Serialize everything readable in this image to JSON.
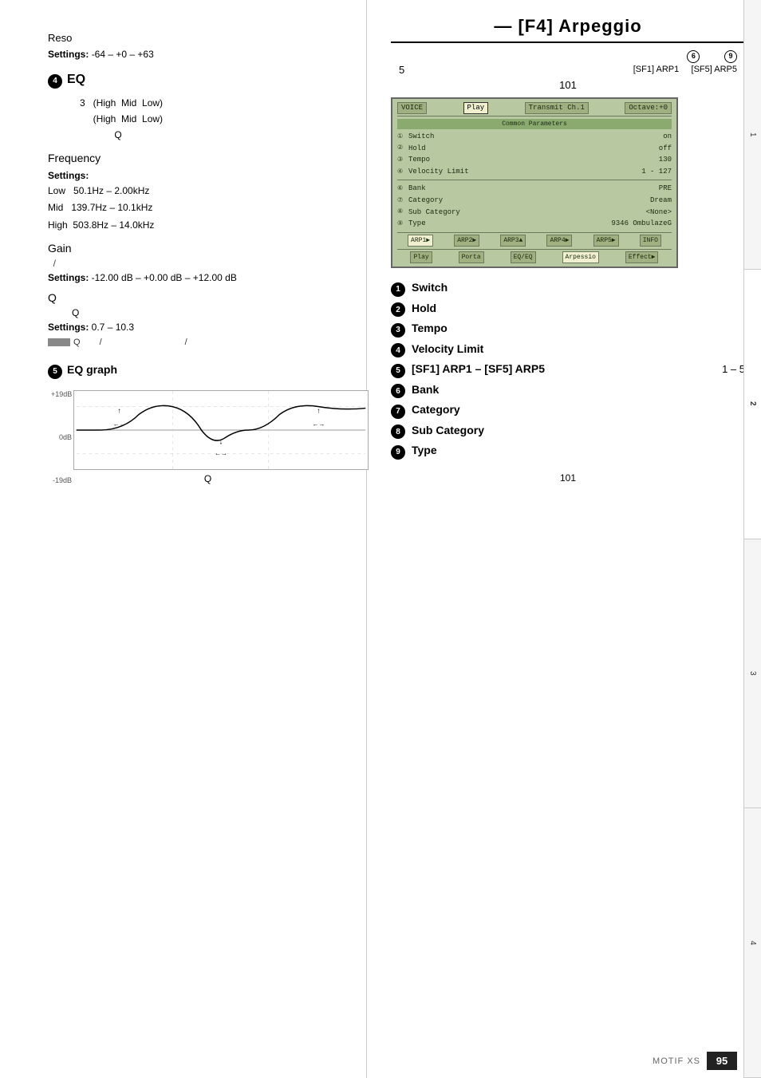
{
  "left": {
    "reso_label": "Reso",
    "settings_reso": "Settings: -64 – +0 – +63",
    "eq_section": {
      "circle_num": "4",
      "title": "EQ",
      "table_rows": [
        {
          "num": "3",
          "cols": [
            "(High",
            "Mid",
            "Low)"
          ]
        },
        {
          "cols": [
            "(High",
            "Mid",
            "Low)"
          ]
        },
        {
          "cols": [
            "",
            "Q",
            ""
          ]
        }
      ],
      "frequency_label": "Frequency",
      "settings_label": "Settings:",
      "freq_settings": [
        "Low   50.1Hz – 2.00kHz",
        "Mid   139.7Hz – 10.1kHz",
        "High  503.8Hz – 14.0kHz"
      ],
      "gain_label": "Gain",
      "gain_note": "/",
      "gain_settings": "Settings: -12.00 dB – +0.00 dB – +12.00 dB",
      "q_label": "Q",
      "q_sub": "Q",
      "q_settings": "Settings: 0.7 – 10.3",
      "q_note_prefix": "Q",
      "q_note_suffix": "/"
    },
    "eq_graph_section": {
      "circle_num": "5",
      "title": "EQ graph",
      "y_labels": [
        "+19dB",
        "0dB",
        "-19dB"
      ],
      "arrows": [
        "←→",
        "←→",
        "←→"
      ],
      "q_label": "Q"
    }
  },
  "right": {
    "title": "— [F4] Arpeggio",
    "sf_num": "5",
    "sf_circle6": "6",
    "sf_circle9": "9",
    "sf_label6": "[SF1] ARP1",
    "sf_label9": "[SF5] ARP5",
    "page_num_top": "101",
    "lcd": {
      "tabs": [
        "VOICE",
        "Play",
        "Transmit Ch.1",
        "Octave:+0"
      ],
      "header": "Common Parameters",
      "rows": [
        {
          "num": "1",
          "label": "Switch",
          "value": "on"
        },
        {
          "num": "2",
          "label": "Hold",
          "value": "off"
        },
        {
          "num": "3",
          "label": "Tempo",
          "value": "130"
        },
        {
          "num": "4",
          "label": "Velocity Limit",
          "value": "1 - 127"
        }
      ],
      "bank_rows": [
        {
          "num": "6",
          "label": "Bank",
          "value": "PRE"
        },
        {
          "num": "7",
          "label": "Category",
          "value": "Dream"
        },
        {
          "num": "8",
          "label": "Sub Category",
          "value": "<None>"
        },
        {
          "num": "9",
          "label": "Type",
          "value": "9346 OmbulazeG"
        }
      ],
      "bottom_tabs": [
        "ARP1▶",
        "ARP2▶",
        "ARP3▲",
        "ARP4▶",
        "ARP5▶",
        "INFO"
      ],
      "bottom_tabs2": [
        "Play",
        "Porta",
        "EQ/EQ",
        "Arpessio",
        "Effect▶"
      ]
    },
    "params": [
      {
        "circle": "1",
        "label": "Switch",
        "range": ""
      },
      {
        "circle": "2",
        "label": "Hold",
        "range": ""
      },
      {
        "circle": "3",
        "label": "Tempo",
        "range": ""
      },
      {
        "circle": "4",
        "label": "Velocity Limit",
        "range": ""
      },
      {
        "circle": "5",
        "label": "[SF1] ARP1 – [SF5] ARP5",
        "range": "1 – 5"
      },
      {
        "circle": "6",
        "label": "Bank",
        "range": ""
      },
      {
        "circle": "7",
        "label": "Category",
        "range": ""
      },
      {
        "circle": "8",
        "label": "Sub Category",
        "range": ""
      },
      {
        "circle": "9",
        "label": "Type",
        "range": ""
      }
    ],
    "page_num_bottom": "101"
  },
  "footer": {
    "motif_label": "MOTIF XS",
    "page_number": "95"
  },
  "sidebar_tabs": [
    "1",
    "2",
    "3",
    "4"
  ]
}
